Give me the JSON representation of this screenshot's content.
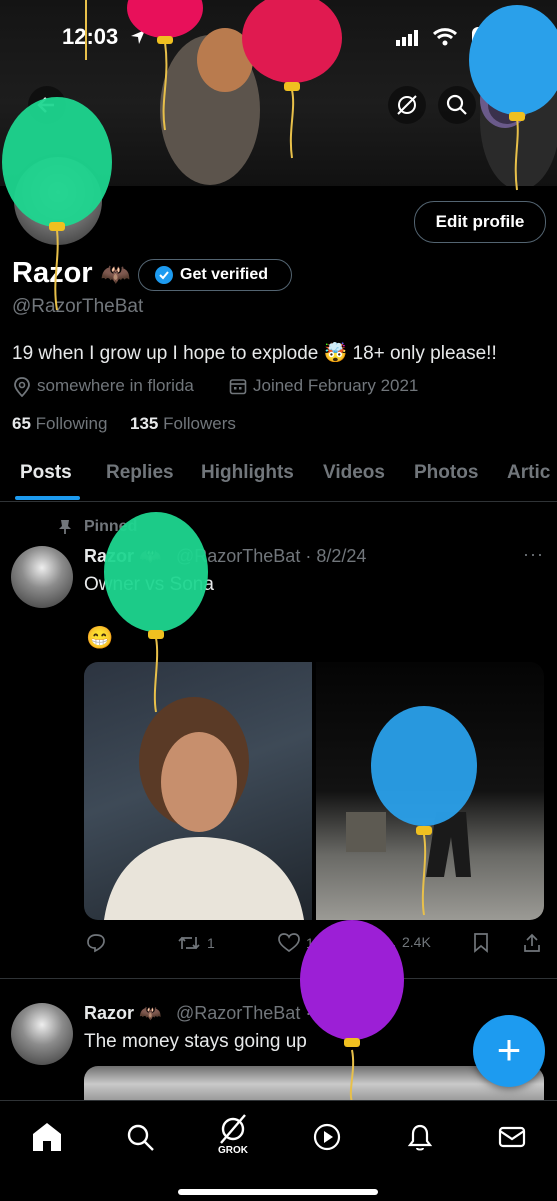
{
  "status_bar": {
    "time": "12:03",
    "battery": "92"
  },
  "profile": {
    "display_name": "Razor",
    "name_emoji": "🦇",
    "get_verified": "Get verified",
    "handle": "@RazorTheBat",
    "bio": "19 when I grow up I hope to explode 🤯 18+ only please!!",
    "location": "somewhere in florida",
    "joined": "Joined February 2021",
    "following_count": "65",
    "following_label": "Following",
    "followers_count": "135",
    "followers_label": "Followers",
    "edit_profile": "Edit profile"
  },
  "tabs": [
    {
      "label": "Posts",
      "active": true
    },
    {
      "label": "Replies"
    },
    {
      "label": "Highlights"
    },
    {
      "label": "Videos"
    },
    {
      "label": "Photos"
    },
    {
      "label": "Artic"
    }
  ],
  "posts": [
    {
      "pinned_label": "Pinned",
      "author": "Razor",
      "author_emoji": "🦇",
      "handle_date": "@RazorTheBat · 8/2/24",
      "text": "Owner vs Sona",
      "emoji_line": "😁",
      "actions": {
        "reposts": "1",
        "likes": "11",
        "views": "2.4K"
      }
    },
    {
      "author": "Razor",
      "author_emoji": "🦇",
      "handle_date": "@RazorTheBat · 1d",
      "text": "The money stays going up"
    }
  ],
  "nav": {
    "grok_label": "GROK"
  },
  "fab": {
    "label": "+"
  },
  "colors": {
    "accent": "#1d9bf0",
    "background": "#000000",
    "muted": "#71767b",
    "border": "#2f3336"
  }
}
